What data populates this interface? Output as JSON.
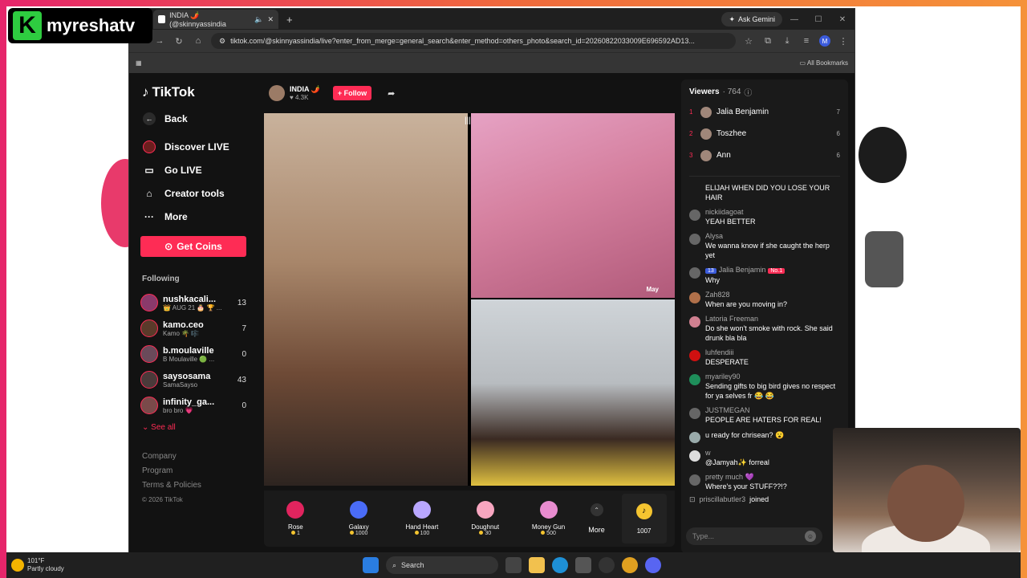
{
  "brand": {
    "mark": "K",
    "name": "myreshatv"
  },
  "browser": {
    "tab_title": "INDIA 🌶️ (@skinnyassindia",
    "ask_gemini": "Ask Gemini",
    "url": "tiktok.com/@skinnyassindia/live?enter_from_merge=general_search&enter_method=others_photo&search_id=20260822033009E696592AD13...",
    "profile_initial": "M",
    "bookmarks": "All Bookmarks"
  },
  "sidebar": {
    "logo": "TikTok",
    "back": "Back",
    "nav": [
      {
        "label": "Discover LIVE"
      },
      {
        "label": "Go LIVE"
      },
      {
        "label": "Creator tools"
      },
      {
        "label": "More"
      }
    ],
    "get_coins": "Get Coins",
    "following_title": "Following",
    "following": [
      {
        "name": "nushkacali...",
        "sub": "👑 AUG 21 🎂 🏆 ...",
        "count": "13"
      },
      {
        "name": "kamo.ceo",
        "sub": "Kamo 🌴 🎼",
        "count": "7"
      },
      {
        "name": "b.moulaville",
        "sub": "B Moulaville 🟢 ...",
        "count": "0"
      },
      {
        "name": "saysosama",
        "sub": "SamaSayso",
        "count": "43"
      },
      {
        "name": "infinity_ga...",
        "sub": "bro bro 💗",
        "count": "0"
      }
    ],
    "see_all": "See all",
    "footer": {
      "company": "Company",
      "program": "Program",
      "terms": "Terms & Policies",
      "copyright": "© 2026 TikTok"
    }
  },
  "stream": {
    "host_name": "INDIA 🌶️",
    "viewers_short": "4.3K",
    "follow": "+ Follow",
    "guest_label": "May",
    "gifts": [
      {
        "name": "Rose",
        "price": "1",
        "color": "#e0245e"
      },
      {
        "name": "Galaxy",
        "price": "1000",
        "color": "#4a6cf7"
      },
      {
        "name": "Hand Heart",
        "price": "100",
        "color": "#b9a7ff"
      },
      {
        "name": "Doughnut",
        "price": "30",
        "color": "#f7a6c0"
      },
      {
        "name": "Money Gun",
        "price": "500",
        "color": "#e88ccf"
      }
    ],
    "more": "More",
    "coin_balance": "1007"
  },
  "chat": {
    "viewers_title": "Viewers",
    "viewers_count": "764",
    "top_viewers": [
      {
        "rank": "1",
        "name": "Jalia Benjamin",
        "count": "7"
      },
      {
        "rank": "2",
        "name": "Toszhee",
        "count": "6"
      },
      {
        "rank": "3",
        "name": "Ann",
        "count": "6"
      }
    ],
    "messages": [
      {
        "user": "",
        "text": "ELIJAH WHEN DID YOU LOSE YOUR HAIR"
      },
      {
        "user": "nickiidagoat",
        "text": "YEAH BETTER"
      },
      {
        "user": "Alysa",
        "text": "We wanna know if she caught the herp yet"
      },
      {
        "user": "Jalia Benjamin",
        "text": "Why"
      },
      {
        "user": "Zah828",
        "text": "When are you moving in?"
      },
      {
        "user": "Latoria Freeman",
        "text": "Do she won't smoke with rock. She said drunk bla bla"
      },
      {
        "user": "luhfendiii",
        "text": "DESPERATE"
      },
      {
        "user": "myariley90",
        "text": "Sending gifts to big bird gives no respect for ya selves fr 😂 😂"
      },
      {
        "user": "JUSTMEGAN",
        "text": "PEOPLE ARE HATERS FOR REAL!"
      },
      {
        "user": "",
        "text": "u ready for chrisean? 😮"
      },
      {
        "user": "w",
        "text": "@Jamyah✨ forreal"
      },
      {
        "user": "pretty much 💜",
        "text": "Where's your STUFF??!?"
      }
    ],
    "jalia_level": "13",
    "jalia_badge": "No.1",
    "joined_user": "priscillabutler3",
    "joined_text": "joined",
    "input_placeholder": "Type..."
  },
  "taskbar": {
    "temp": "101°F",
    "cond": "Partly cloudy",
    "search": "Search"
  }
}
